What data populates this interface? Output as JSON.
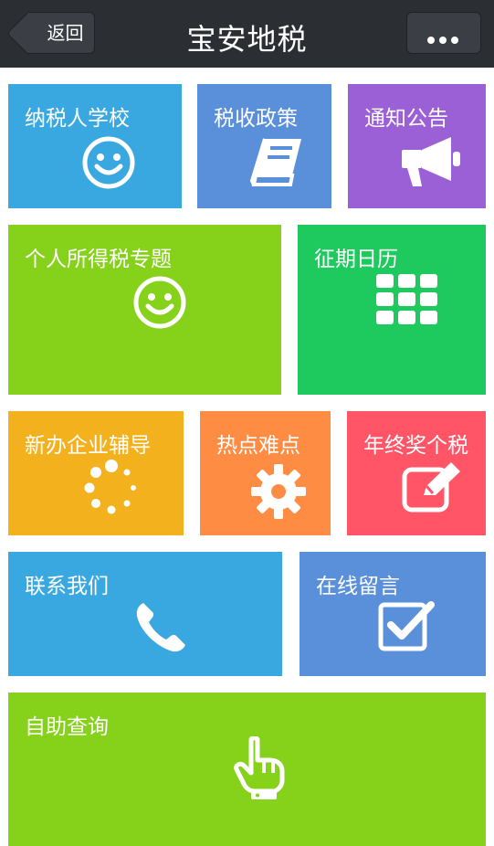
{
  "header": {
    "title": "宝安地税",
    "back_label": "返回",
    "more_icon": "more-dots-icon"
  },
  "tiles": [
    {
      "id": "tile-taxpayer-school",
      "label": "纳税人学校",
      "icon": "smiley-icon",
      "color": "#3aa8e0"
    },
    {
      "id": "tile-tax-policy",
      "label": "税收政策",
      "icon": "book-icon",
      "color": "#5a8fd9"
    },
    {
      "id": "tile-notices",
      "label": "通知公告",
      "icon": "megaphone-icon",
      "color": "#9b5fd6"
    },
    {
      "id": "tile-personal-income-tax",
      "label": "个人所得税专题",
      "icon": "smiley-icon",
      "color": "#86d11a"
    },
    {
      "id": "tile-tax-calendar",
      "label": "征期日历",
      "icon": "calendar-grid-icon",
      "color": "#1ec95d"
    },
    {
      "id": "tile-new-business",
      "label": "新办企业辅导",
      "icon": "loading-spinner-icon",
      "color": "#f4b11e"
    },
    {
      "id": "tile-hot-topics",
      "label": "热点难点",
      "icon": "gear-icon",
      "color": "#ff8c43"
    },
    {
      "id": "tile-year-end-bonus",
      "label": "年终奖个税",
      "icon": "edit-icon",
      "color": "#ff5567"
    },
    {
      "id": "tile-contact-us",
      "label": "联系我们",
      "icon": "phone-icon",
      "color": "#3aa8e0"
    },
    {
      "id": "tile-leave-message",
      "label": "在线留言",
      "icon": "checkbox-icon",
      "color": "#5a8fd9"
    },
    {
      "id": "tile-self-service",
      "label": "自助查询",
      "icon": "hand-pointer-icon",
      "color": "#86d11a"
    }
  ]
}
